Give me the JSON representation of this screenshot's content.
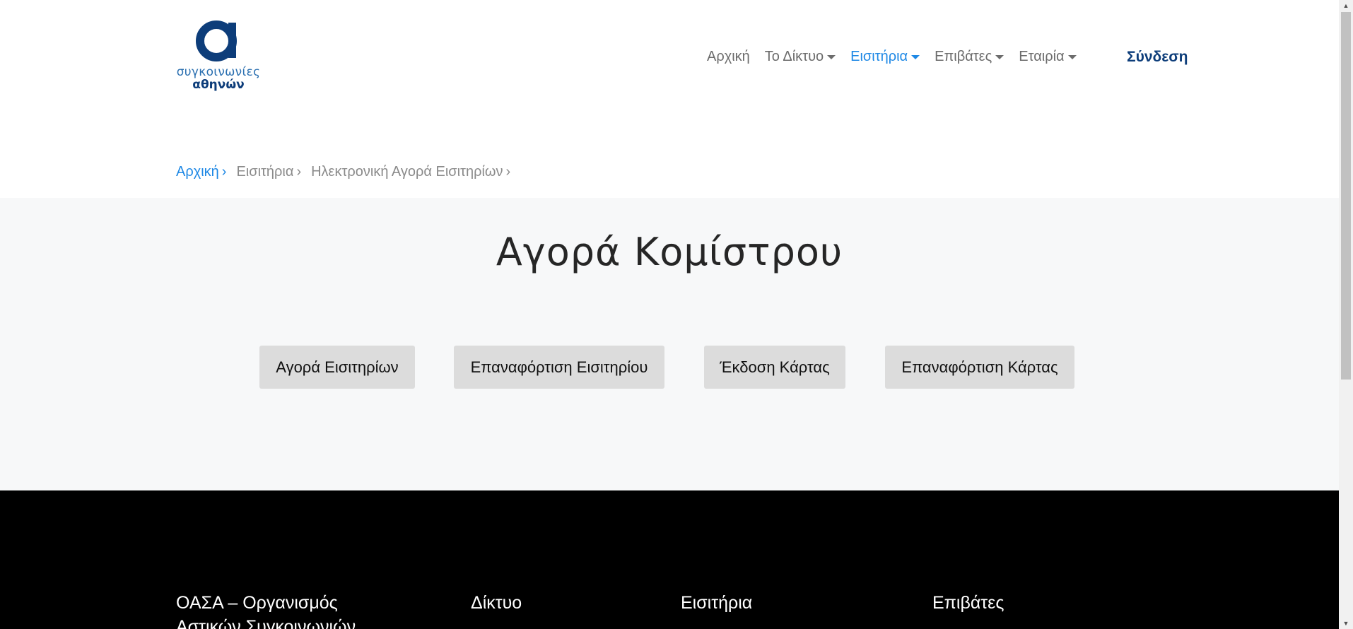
{
  "logo": {
    "line1": "συγκοινωνίες",
    "line2": "αθηνών",
    "color": "#0d3d7a"
  },
  "nav": {
    "items": [
      {
        "label": "Αρχική",
        "dropdown": false,
        "active": false
      },
      {
        "label": "Το Δίκτυο",
        "dropdown": true,
        "active": false
      },
      {
        "label": "Εισιτήρια",
        "dropdown": true,
        "active": true
      },
      {
        "label": "Επιβάτες",
        "dropdown": true,
        "active": false
      },
      {
        "label": "Εταιρία",
        "dropdown": true,
        "active": false
      }
    ],
    "login_label": "Σύνδεση",
    "active_color": "#1e88e5"
  },
  "breadcrumb": {
    "items": [
      "Αρχική",
      "Εισιτήρια",
      "Ηλεκτρονική Αγορά Εισιτηρίων"
    ]
  },
  "main": {
    "title": "Αγορά Κομίστρου",
    "buttons": [
      "Αγορά Εισιτηρίων",
      "Επαναφόρτιση Εισιτηρίου",
      "Έκδοση Κάρτας",
      "Επαναφόρτιση Κάρτας"
    ],
    "background": "#f7f8f9"
  },
  "footer": {
    "columns": [
      "ΟΑΣΑ – Οργανισμός Αστικών Συγκοινωνιών",
      "Δίκτυο",
      "Εισιτήρια",
      "Επιβάτες"
    ],
    "background": "#000000"
  }
}
